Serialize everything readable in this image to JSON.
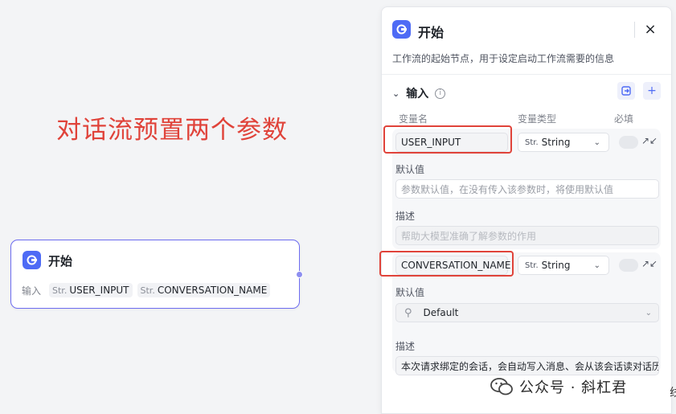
{
  "annotation": "对话流预置两个参数",
  "node": {
    "title": "开始",
    "inputs_label": "输入",
    "inputs": [
      {
        "type": "Str.",
        "name": "USER_INPUT"
      },
      {
        "type": "Str.",
        "name": "CONVERSATION_NAME"
      }
    ]
  },
  "panel": {
    "title": "开始",
    "description": "工作流的起始节点，用于设定启动工作流需要的信息",
    "close_icon": "×",
    "section_title": "输入",
    "info_icon": "i",
    "columns": {
      "name": "变量名",
      "type": "变量类型",
      "required": "必填"
    },
    "variables": [
      {
        "name": "USER_INPUT",
        "type_prefix": "Str.",
        "type": "String",
        "default_label": "默认值",
        "default_placeholder": "参数默认值，在没有传入该参数时，将使用默认值",
        "desc_label": "描述",
        "desc_placeholder": "帮助大模型准确了解参数的作用"
      },
      {
        "name": "CONVERSATION_NAME",
        "type_prefix": "Str.",
        "type": "String",
        "default_label": "默认值",
        "default_value": "Default",
        "desc_label": "描述",
        "desc_value": "本次请求绑定的会话，会自动写入消息、会从该会话读对话历"
      }
    ]
  },
  "watermark": {
    "text": "公众号 · 斜杠君"
  },
  "edge_text": "线"
}
